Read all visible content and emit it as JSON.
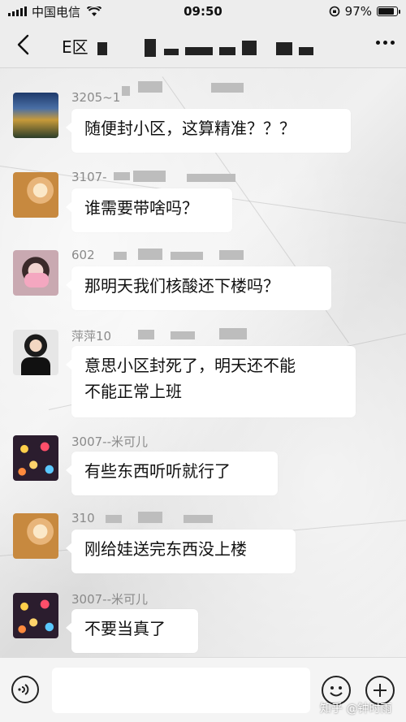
{
  "status_bar": {
    "carrier": "中国电信",
    "time": "09:50",
    "battery_percent": "97%",
    "battery_level": 0.97
  },
  "nav": {
    "title": "E区"
  },
  "messages": [
    {
      "sender": "3205~1",
      "text": "随便封小区，这算精准？？？",
      "avatar_icon": "landscape-avatar"
    },
    {
      "sender": "3107-",
      "text": "谁需要带啥吗？",
      "avatar_icon": "girl-avatar"
    },
    {
      "sender": "602",
      "text": "那明天我们核酸还下楼吗？",
      "avatar_icon": "masked-girl-avatar"
    },
    {
      "sender": "萍萍10",
      "text_lines": [
        "意思小区封死了，明天还不能",
        "不能正常上班"
      ],
      "avatar_icon": "woman-avatar"
    },
    {
      "sender": "3007--米可儿",
      "text": "有些东西听听就行了",
      "avatar_icon": "lights-avatar"
    },
    {
      "sender": "310",
      "text": "刚给娃送完东西没上楼",
      "avatar_icon": "girl-avatar"
    },
    {
      "sender": "3007--米可儿",
      "text": "不要当真了",
      "avatar_icon": "lights-avatar"
    }
  ],
  "input_bar": {
    "voice_icon": "voice-icon",
    "emoji_icon": "emoji-icon",
    "plus_icon": "plus-icon"
  },
  "watermark": "知乎 @钟时雨"
}
